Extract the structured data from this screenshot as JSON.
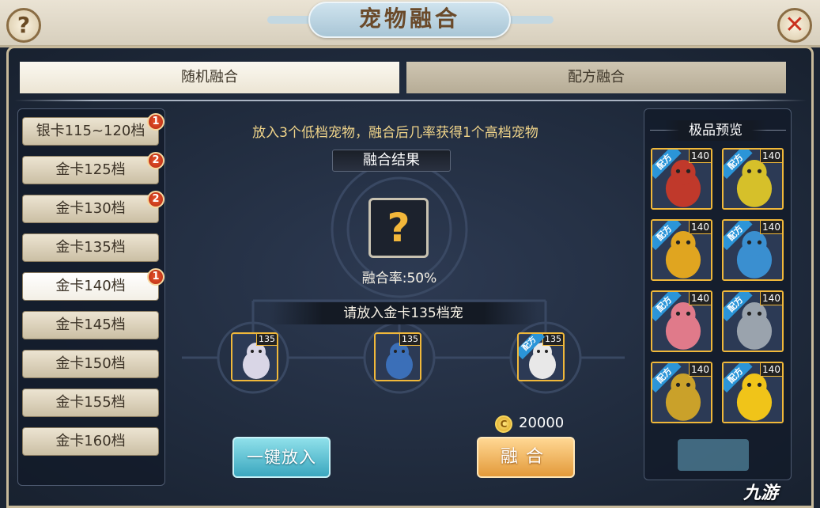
{
  "header": {
    "title": "宠物融合",
    "help_icon": "?",
    "close_icon": "✕"
  },
  "tabs": [
    {
      "label": "随机融合",
      "active": true
    },
    {
      "label": "配方融合",
      "active": false
    }
  ],
  "tiers": [
    {
      "label": "银卡115~120档",
      "badge": "1",
      "selected": false
    },
    {
      "label": "金卡125档",
      "badge": "2",
      "selected": false
    },
    {
      "label": "金卡130档",
      "badge": "2",
      "selected": false
    },
    {
      "label": "金卡135档",
      "badge": "",
      "selected": false
    },
    {
      "label": "金卡140档",
      "badge": "1",
      "selected": true
    },
    {
      "label": "金卡145档",
      "badge": "",
      "selected": false
    },
    {
      "label": "金卡150档",
      "badge": "",
      "selected": false
    },
    {
      "label": "金卡155档",
      "badge": "",
      "selected": false
    },
    {
      "label": "金卡160档",
      "badge": "",
      "selected": false
    }
  ],
  "fusion": {
    "instruction": "放入3个低档宠物，融合后几率获得1个高档宠物",
    "result_label": "融合结果",
    "result_placeholder": "?",
    "rate_text": "融合率:50%",
    "hint": "请放入金卡135档宠",
    "slots": [
      {
        "level": "135",
        "recipe": false,
        "pet": "white-bunny",
        "color": "#d9d6e6"
      },
      {
        "level": "135",
        "recipe": false,
        "pet": "armored-pig",
        "color": "#3b6fb8"
      },
      {
        "level": "135",
        "recipe": true,
        "pet": "white-fox",
        "color": "#e8e8e8"
      }
    ],
    "recipe_tag": "配方",
    "cost": "20000",
    "coin_icon": "C",
    "put_in_button": "一键放入",
    "fuse_button": "融合"
  },
  "preview": {
    "title": "极品预览",
    "recipe_tag": "配方",
    "cards": [
      {
        "level": "140",
        "pet": "armored-warrior",
        "color": "#c0392b"
      },
      {
        "level": "140",
        "pet": "green-sprite",
        "color": "#d6c02a"
      },
      {
        "level": "140",
        "pet": "golden-dragon",
        "color": "#e0a520"
      },
      {
        "level": "140",
        "pet": "blue-hood",
        "color": "#3a8fd0"
      },
      {
        "level": "140",
        "pet": "pink-beast",
        "color": "#e07a8a"
      },
      {
        "level": "140",
        "pet": "steel-golem",
        "color": "#9aa3ad"
      },
      {
        "level": "140",
        "pet": "gold-serpent",
        "color": "#caa12a"
      },
      {
        "level": "140",
        "pet": "yellow-bird",
        "color": "#f0c419"
      }
    ]
  },
  "watermark": "九游"
}
